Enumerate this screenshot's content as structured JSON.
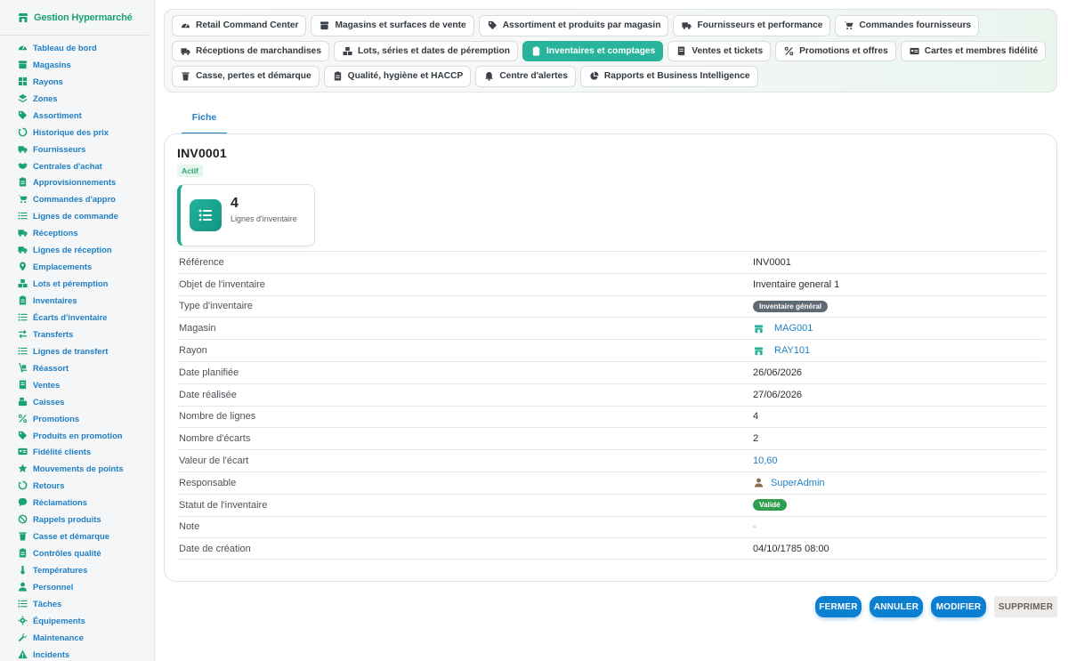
{
  "app": {
    "brand": "Gestion Hypermarché",
    "brand_color": "#1aa36f",
    "link_color": "#1f7fc4",
    "accent": "#27b49a"
  },
  "sidebar": {
    "items": [
      {
        "label": "Tableau de bord",
        "icon": "dashboard-icon"
      },
      {
        "label": "Magasins",
        "icon": "store-icon"
      },
      {
        "label": "Rayons",
        "icon": "grid-icon"
      },
      {
        "label": "Zones",
        "icon": "layers-icon"
      },
      {
        "label": "Assortiment",
        "icon": "tags-icon"
      },
      {
        "label": "Historique des prix",
        "icon": "history-icon"
      },
      {
        "label": "Fournisseurs",
        "icon": "truck-icon"
      },
      {
        "label": "Centrales d'achat",
        "icon": "handshake-icon"
      },
      {
        "label": "Approvisionnements",
        "icon": "clipboard-icon"
      },
      {
        "label": "Commandes d'appro",
        "icon": "cart-icon"
      },
      {
        "label": "Lignes de commande",
        "icon": "list-icon"
      },
      {
        "label": "Réceptions",
        "icon": "truck-loading-icon"
      },
      {
        "label": "Lignes de réception",
        "icon": "truck-icon"
      },
      {
        "label": "Emplacements",
        "icon": "map-marker-icon"
      },
      {
        "label": "Lots et péremption",
        "icon": "boxes-icon"
      },
      {
        "label": "Inventaires",
        "icon": "clipboard-list-icon"
      },
      {
        "label": "Écarts d'inventaire",
        "icon": "list-icon"
      },
      {
        "label": "Transferts",
        "icon": "exchange-icon"
      },
      {
        "label": "Lignes de transfert",
        "icon": "list-icon"
      },
      {
        "label": "Réassort",
        "icon": "dolly-icon"
      },
      {
        "label": "Ventes",
        "icon": "receipt-icon"
      },
      {
        "label": "Caisses",
        "icon": "cash-register-icon"
      },
      {
        "label": "Promotions",
        "icon": "percent-icon"
      },
      {
        "label": "Produits en promotion",
        "icon": "tag-icon"
      },
      {
        "label": "Fidélité clients",
        "icon": "id-card-icon"
      },
      {
        "label": "Mouvements de points",
        "icon": "star-icon"
      },
      {
        "label": "Retours",
        "icon": "undo-icon"
      },
      {
        "label": "Réclamations",
        "icon": "comment-icon"
      },
      {
        "label": "Rappels produits",
        "icon": "ban-icon"
      },
      {
        "label": "Casse et démarque",
        "icon": "trash-icon"
      },
      {
        "label": "Contrôles qualité",
        "icon": "clipboard-check-icon"
      },
      {
        "label": "Températures",
        "icon": "thermometer-icon"
      },
      {
        "label": "Personnel",
        "icon": "user-icon"
      },
      {
        "label": "Tâches",
        "icon": "tasks-icon"
      },
      {
        "label": "Équipements",
        "icon": "cogs-icon"
      },
      {
        "label": "Maintenance",
        "icon": "wrench-icon"
      },
      {
        "label": "Incidents",
        "icon": "warning-icon"
      }
    ]
  },
  "topnav": {
    "rows": [
      [
        {
          "label": "Retail Command Center",
          "icon": "gauge-icon",
          "active": false
        },
        {
          "label": "Magasins et surfaces de vente",
          "icon": "store-icon",
          "active": false
        },
        {
          "label": "Assortiment et produits par magasin",
          "icon": "tags-icon",
          "active": false
        },
        {
          "label": "Fournisseurs et performance",
          "icon": "truck-icon",
          "active": false
        },
        {
          "label": "Commandes fournisseurs",
          "icon": "cart-icon",
          "active": false
        }
      ],
      [
        {
          "label": "Réceptions de marchandises",
          "icon": "truck-loading-icon",
          "active": false
        },
        {
          "label": "Lots, séries et dates de péremption",
          "icon": "boxes-icon",
          "active": false
        },
        {
          "label": "Inventaires et comptages",
          "icon": "clipboard-list-icon",
          "active": true
        },
        {
          "label": "Ventes et tickets",
          "icon": "receipt-icon",
          "active": false
        },
        {
          "label": "Promotions et offres",
          "icon": "percent-icon",
          "active": false
        },
        {
          "label": "Cartes et membres fidélité",
          "icon": "id-card-icon",
          "active": false
        }
      ],
      [
        {
          "label": "Casse, pertes et démarque",
          "icon": "trash-icon",
          "active": false
        },
        {
          "label": "Qualité, hygiène et HACCP",
          "icon": "clipboard-check-icon",
          "active": false
        },
        {
          "label": "Centre d'alertes",
          "icon": "bell-icon",
          "active": false
        },
        {
          "label": "Rapports et Business Intelligence",
          "icon": "pie-chart-icon",
          "active": false
        }
      ]
    ]
  },
  "tabs": [
    {
      "label": "Fiche",
      "active": true
    }
  ],
  "record": {
    "title": "INV0001",
    "status": "Actif",
    "stat": {
      "value": "4",
      "label": "Lignes d'inventaire"
    },
    "fields": [
      {
        "key": "Référence",
        "value": "INV0001",
        "kind": "text"
      },
      {
        "key": "Objet de l'inventaire",
        "value": "Inventaire general 1",
        "kind": "text"
      },
      {
        "key": "Type d'inventaire",
        "value": "Inventaire général",
        "kind": "badge-grey"
      },
      {
        "key": "Magasin",
        "value": "MAG001",
        "kind": "link-store"
      },
      {
        "key": "Rayon",
        "value": "RAY101",
        "kind": "link-store"
      },
      {
        "key": "Date planifiée",
        "value": "26/06/2026",
        "kind": "text"
      },
      {
        "key": "Date réalisée",
        "value": "27/06/2026",
        "kind": "text"
      },
      {
        "key": "Nombre de lignes",
        "value": "4",
        "kind": "text"
      },
      {
        "key": "Nombre d'écarts",
        "value": "2",
        "kind": "text"
      },
      {
        "key": "Valeur de l'écart",
        "value": "10,60",
        "kind": "link"
      },
      {
        "key": "Responsable",
        "value": "SuperAdmin",
        "kind": "link-user"
      },
      {
        "key": "Statut de l'inventaire",
        "value": "Validé",
        "kind": "badge-green"
      },
      {
        "key": "Note",
        "value": "-",
        "kind": "muted"
      },
      {
        "key": "Date de création",
        "value": "04/10/1785 08:00",
        "kind": "text"
      }
    ]
  },
  "actions": {
    "close": "FERMER",
    "cancel": "ANNULER",
    "edit": "MODIFIER",
    "delete": "SUPPRIMER"
  }
}
